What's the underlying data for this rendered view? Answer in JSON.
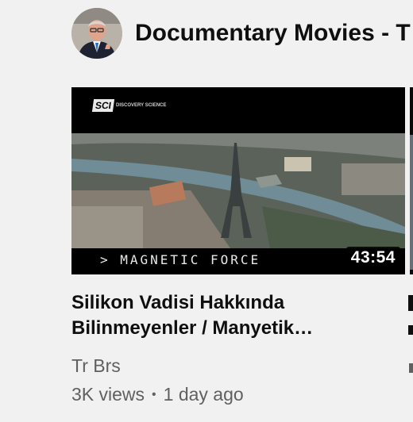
{
  "shelf": {
    "channel_title": "Documentary Movies - T"
  },
  "video": {
    "title_line1": "Silikon Vadisi Hakkında",
    "title_line2": "Bilinmeyenler / Manyetik…",
    "channel": "Tr Brs",
    "views": "3K views",
    "separator": "•",
    "age": "1 day ago",
    "duration": "43:54",
    "thumbnail_caption": "> MAGNETIC FORCE",
    "logo_text": "SCI",
    "logo_subtext": "DISCOVERY SCIENCE"
  },
  "icons": {
    "avatar": "channel-avatar-person"
  },
  "colors": {
    "background": "#f1f1f1",
    "title": "#0f0f0f",
    "secondary": "#606060"
  }
}
